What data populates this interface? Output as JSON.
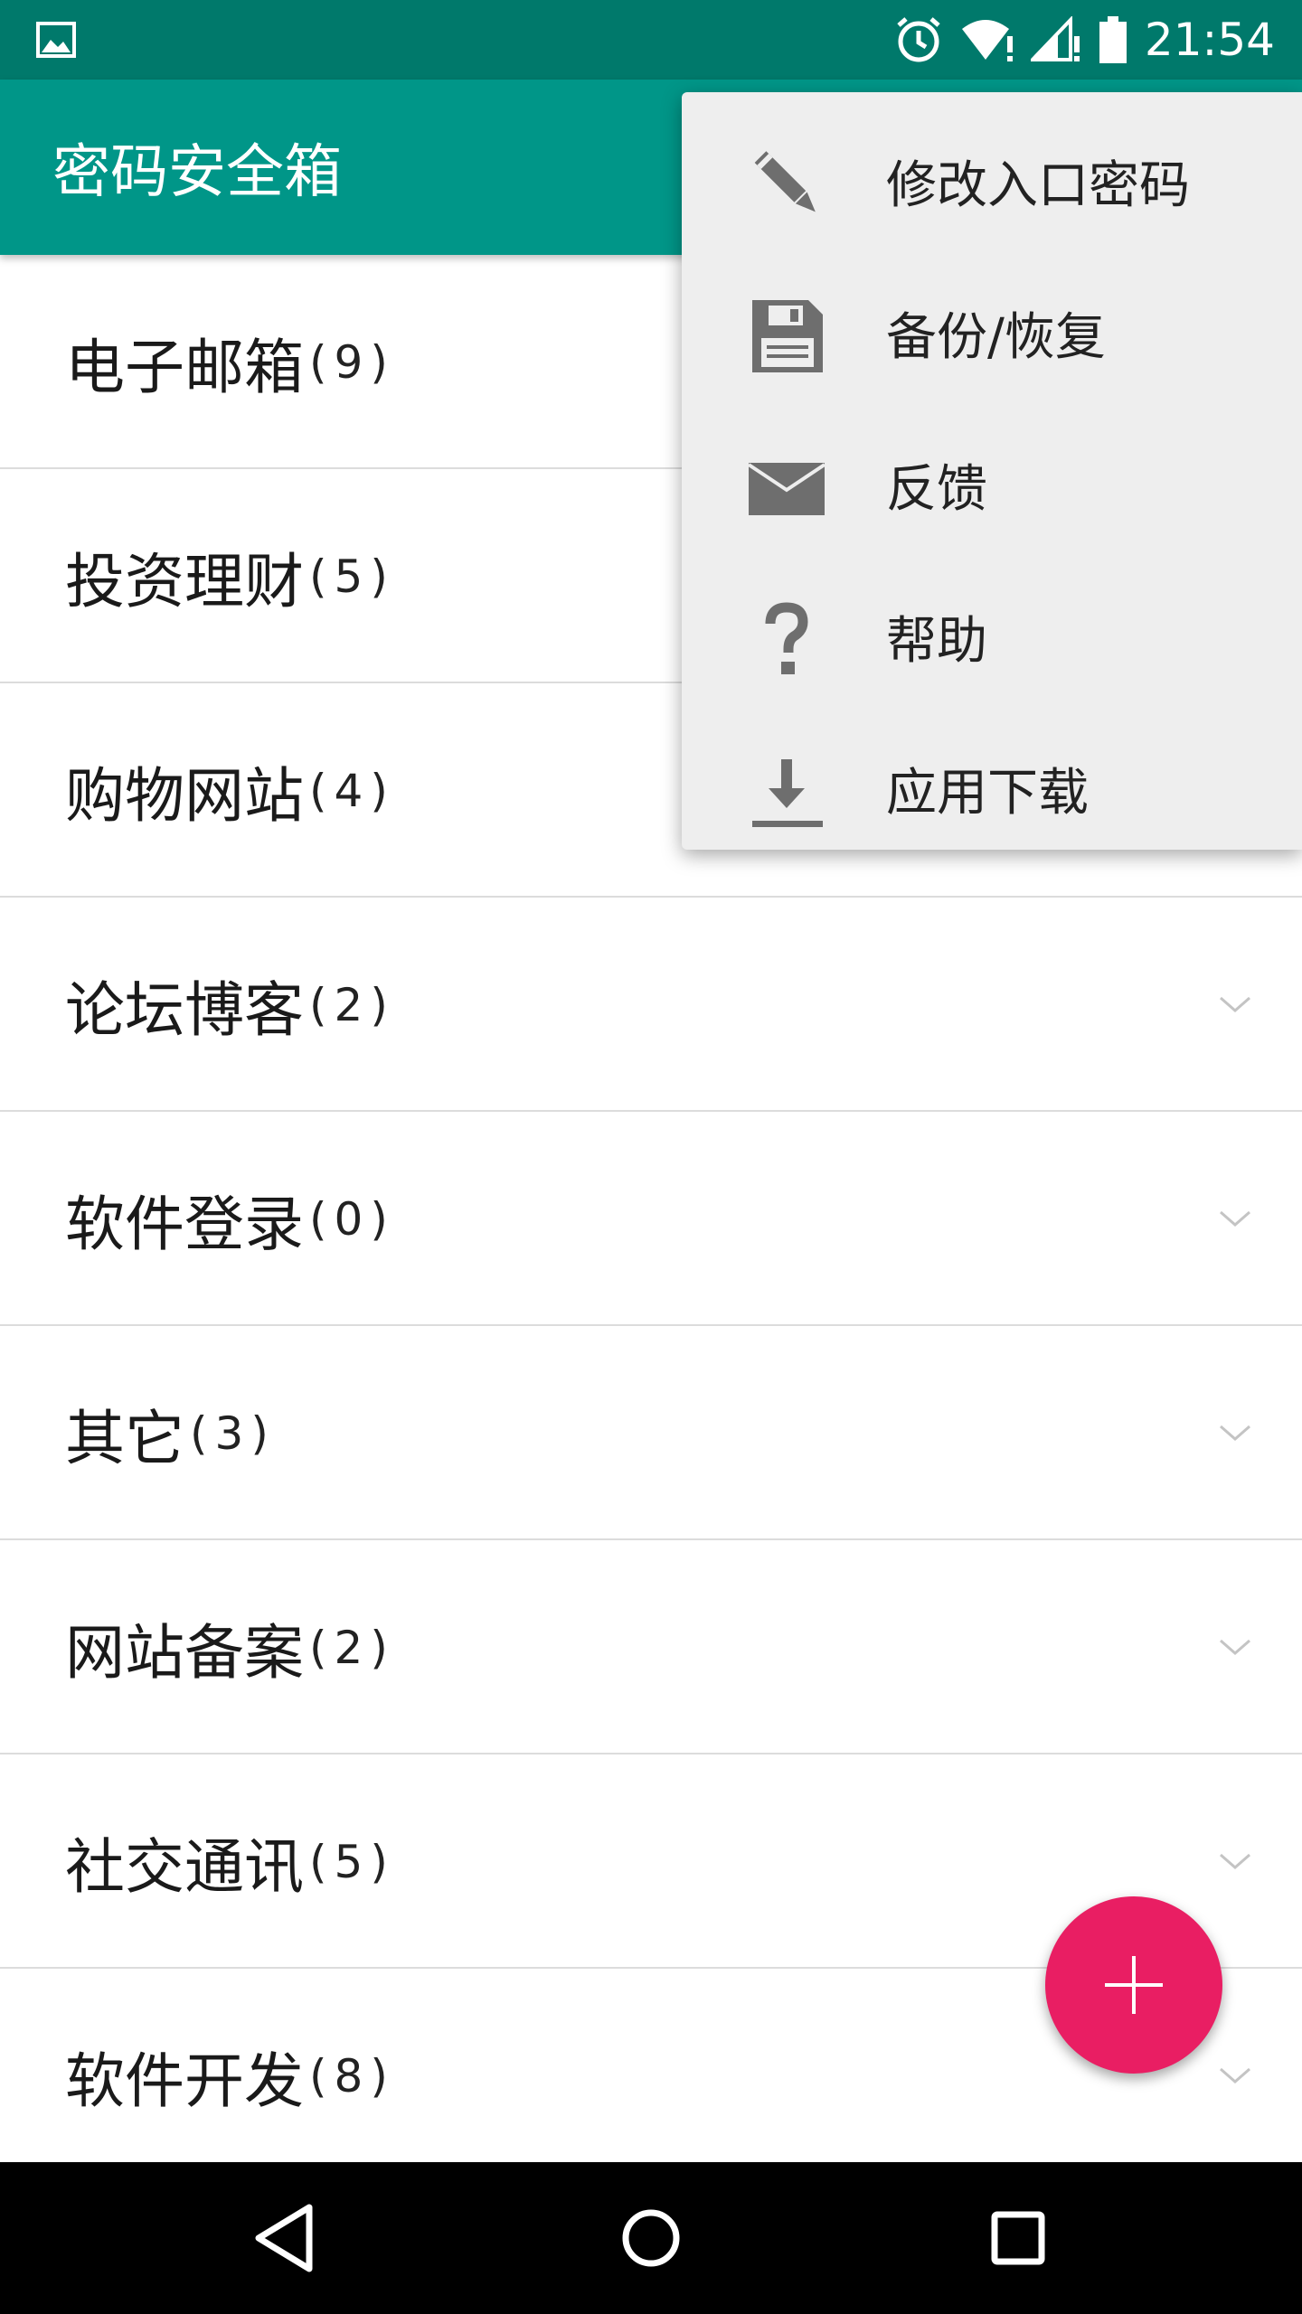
{
  "status_bar": {
    "time": "21:54",
    "icons": [
      "gallery-icon",
      "alarm-icon",
      "wifi-icon",
      "signal-icon",
      "battery-icon"
    ]
  },
  "app_bar": {
    "title": "密码安全箱"
  },
  "categories": [
    {
      "name": "电子邮箱",
      "count": "(9)"
    },
    {
      "name": "投资理财",
      "count": "(5)"
    },
    {
      "name": "购物网站",
      "count": "(4)"
    },
    {
      "name": "论坛博客",
      "count": "(2)"
    },
    {
      "name": "软件登录",
      "count": "(0)"
    },
    {
      "name": "其它",
      "count": "(3)"
    },
    {
      "name": "网站备案",
      "count": "(2)"
    },
    {
      "name": "社交通讯",
      "count": "(5)"
    },
    {
      "name": "软件开发",
      "count": "(8)"
    }
  ],
  "menu": {
    "items": [
      {
        "label": "修改入口密码",
        "icon": "pencil-icon"
      },
      {
        "label": "备份/恢复",
        "icon": "save-icon"
      },
      {
        "label": "反馈",
        "icon": "mail-icon"
      },
      {
        "label": "帮助",
        "icon": "help-icon"
      },
      {
        "label": "应用下载",
        "icon": "download-icon"
      }
    ]
  },
  "fab": {
    "icon": "plus-icon"
  },
  "nav_bar": {
    "icons": [
      "back-icon",
      "home-icon",
      "recents-icon"
    ]
  },
  "colors": {
    "status_bar": "#00796b",
    "app_bar": "#009688",
    "fab": "#e91e63",
    "menu_bg": "#eeeeee",
    "icon_gray": "#757575"
  }
}
